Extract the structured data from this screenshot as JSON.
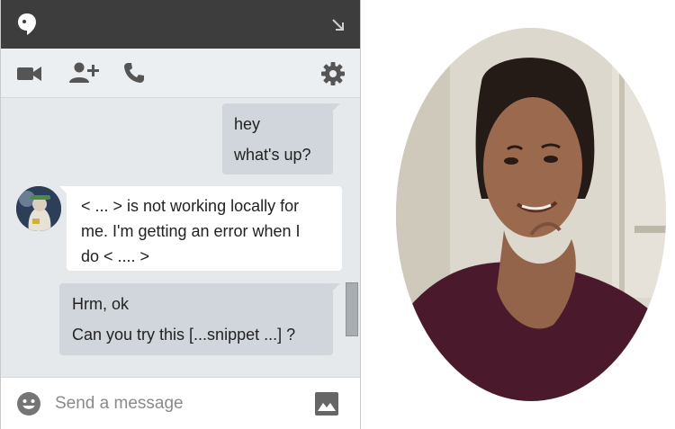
{
  "composer": {
    "placeholder": "Send a message"
  },
  "messages": [
    {
      "from": "self",
      "lines": [
        "hey",
        "what's up?"
      ]
    },
    {
      "from": "other",
      "lines": [
        "< ... > is not working locally for",
        "me. I'm getting an error when I",
        "do < .... >"
      ]
    },
    {
      "from": "self",
      "lines": [
        "Hrm, ok",
        "Can you try this [...snippet ...] ?"
      ]
    }
  ],
  "icons": {
    "titlebar": [
      "hangouts-logo-icon",
      "popout-arrow-icon"
    ],
    "toolbar": [
      "video-camera-icon",
      "add-person-icon",
      "phone-icon",
      "gear-icon"
    ],
    "composer": [
      "emoji-icon",
      "image-icon"
    ]
  },
  "colors": {
    "titlebar": "#3d3d3d",
    "toolbar": "#eceff1",
    "chat_background": "#e5e9ec",
    "own_bubble": "#d0d6db",
    "other_bubble": "#ffffff",
    "icon": "#555555"
  }
}
